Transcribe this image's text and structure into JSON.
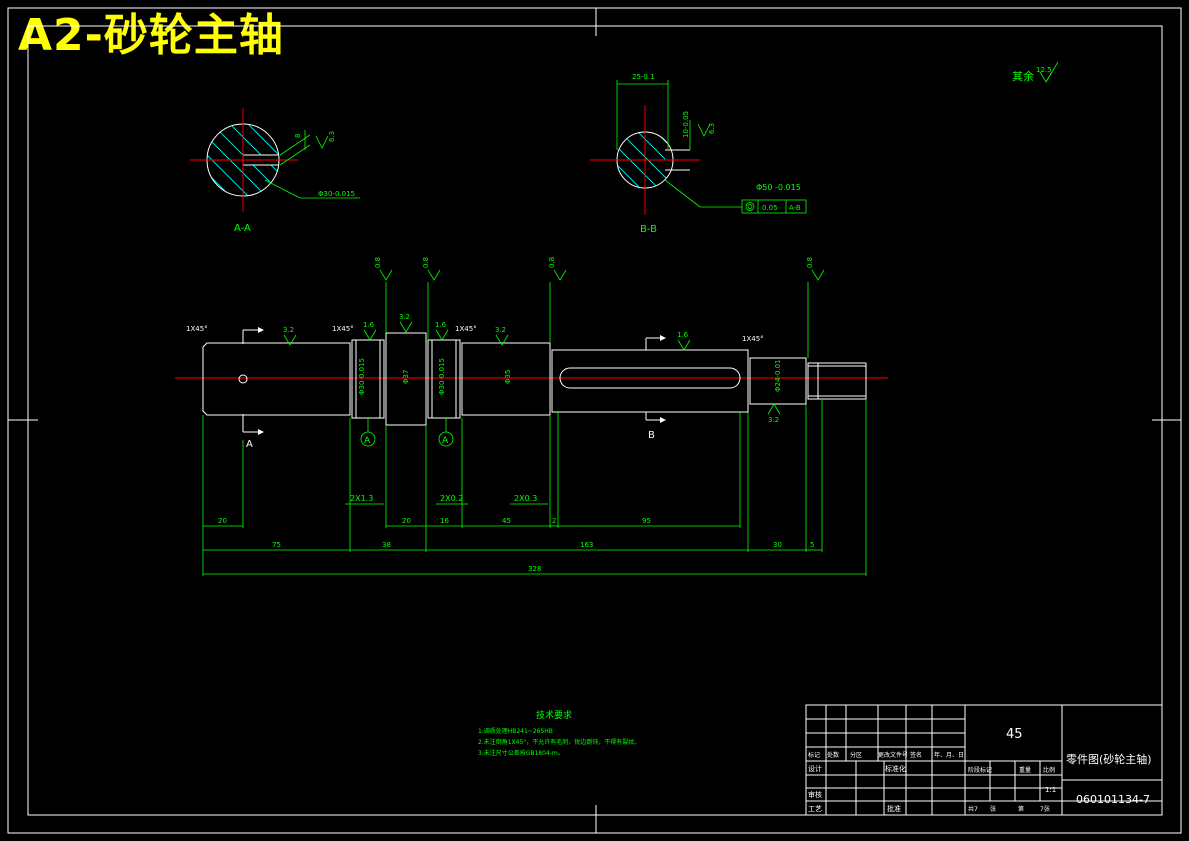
{
  "banner": "A2-砂轮主轴",
  "colors": {
    "background": "#000000",
    "outline": "#ffffff",
    "dimension": "#00ff00",
    "centerline": "#ff0000",
    "hatch": "#00ffff",
    "banner": "#ffff00"
  },
  "views": {
    "section_a_label": "A-A",
    "section_b_label": "B-B",
    "section_a_dims": [
      "8",
      "6.3",
      "Φ30-0.015"
    ],
    "section_b_dims": [
      "25-0.1",
      "10-0.05",
      "6.3",
      "Φ50 -0.015",
      "0.05",
      "A-B"
    ]
  },
  "roughness_other": {
    "label": "其余",
    "value": "12.5"
  },
  "shaft": {
    "chamfers": [
      "1X45°",
      "1X45°",
      "1X45°",
      "1X45°"
    ],
    "roughness": [
      "3.2",
      "1.6",
      "3.2",
      "1.6",
      "3.2",
      "1.6",
      "3.2",
      "0.8",
      "0.8",
      "0.8",
      "0.8"
    ],
    "diameters": [
      "Φ30-0.015",
      "Φ37",
      "Φ30-0.015",
      "Φ35",
      "Φ24-0.01"
    ],
    "section_markers": [
      "A",
      "A",
      "B",
      "B"
    ],
    "datum_tags": [
      "A",
      "A"
    ],
    "grooves": [
      "2X1.3",
      "2X0.2",
      "2X0.3"
    ],
    "dims_row1": [
      "20",
      "20",
      "16",
      "45",
      "2",
      "95"
    ],
    "dims_row2": [
      "75",
      "38",
      "163",
      "30",
      "5"
    ],
    "dim_total": "328"
  },
  "tech_req": {
    "title": "技术要求",
    "items": [
      "1.调质处理HB241~265HB",
      "2.未注倒角1X45°，不允许有毛刺，锐边倒钝，不得有裂纹。",
      "3.未注尺寸公差按GB1804-m。"
    ]
  },
  "title_block": {
    "material": "45",
    "drawing_name": "零件图(砂轮主轴)",
    "drawing_number": "060101134-7",
    "scale": "1:1",
    "sheet_info": [
      "共7",
      "张",
      "第",
      "7张"
    ],
    "header_labels": [
      "标记",
      "处数",
      "分区",
      "更改文件号",
      "签名",
      "年、月、日"
    ],
    "row_labels": [
      "设计",
      "标准化",
      "审核",
      "工艺",
      "批准"
    ],
    "stage_labels": [
      "阶段标记",
      "重量",
      "比例"
    ]
  }
}
